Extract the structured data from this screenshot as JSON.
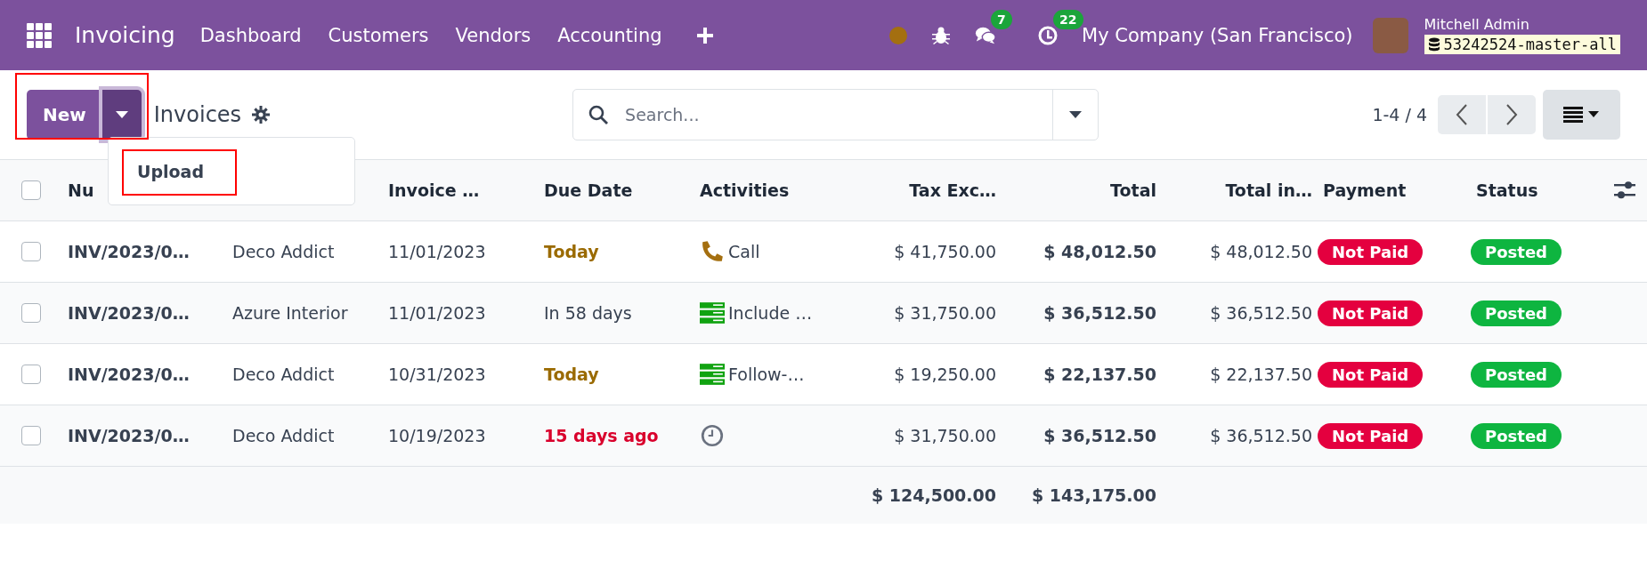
{
  "navbar": {
    "app_name": "Invoicing",
    "menu": [
      "Dashboard",
      "Customers",
      "Vendors",
      "Accounting"
    ],
    "chat_badge": "7",
    "activity_badge": "22",
    "company": "My Company (San Francisco)",
    "user": "Mitchell Admin",
    "database": "53242524-master-all"
  },
  "control_panel": {
    "new_button": "New",
    "highlighted": true,
    "title": "Invoices",
    "search": {
      "placeholder": "Search..."
    },
    "pager": "1-4 / 4"
  },
  "new_menu": {
    "items": [
      {
        "label": "Upload",
        "highlighted": true
      }
    ]
  },
  "table": {
    "all_selected": false,
    "columns": [
      "Nu",
      "Invoice …",
      "Due Date",
      "Activities",
      "Tax Exc…",
      "Total",
      "Total in…",
      "Payment",
      "Status"
    ],
    "rows": [
      {
        "selected": false,
        "number": "INV/2023/0…",
        "customer": "Deco Addict",
        "invoice_date": "11/01/2023",
        "due": {
          "text": "Today",
          "kind": "today"
        },
        "activity": {
          "kind": "phone",
          "text": "Call"
        },
        "tax_excluded": "$ 41,750.00",
        "total": "$ 48,012.50",
        "total_signed": "$ 48,012.50",
        "payment": {
          "text": "Not Paid",
          "kind": "danger"
        },
        "status": {
          "text": "Posted",
          "kind": "success"
        }
      },
      {
        "selected": false,
        "number": "INV/2023/0…",
        "customer": "Azure Interior",
        "invoice_date": "11/01/2023",
        "due": {
          "text": "In 58 days",
          "kind": "future"
        },
        "activity": {
          "kind": "todo",
          "text": "Include …"
        },
        "tax_excluded": "$ 31,750.00",
        "total": "$ 36,512.50",
        "total_signed": "$ 36,512.50",
        "payment": {
          "text": "Not Paid",
          "kind": "danger"
        },
        "status": {
          "text": "Posted",
          "kind": "success"
        }
      },
      {
        "selected": false,
        "number": "INV/2023/0…",
        "customer": "Deco Addict",
        "invoice_date": "10/31/2023",
        "due": {
          "text": "Today",
          "kind": "today"
        },
        "activity": {
          "kind": "todo",
          "text": "Follow-…"
        },
        "tax_excluded": "$ 19,250.00",
        "total": "$ 22,137.50",
        "total_signed": "$ 22,137.50",
        "payment": {
          "text": "Not Paid",
          "kind": "danger"
        },
        "status": {
          "text": "Posted",
          "kind": "success"
        }
      },
      {
        "selected": false,
        "number": "INV/2023/0…",
        "customer": "Deco Addict",
        "invoice_date": "10/19/2023",
        "due": {
          "text": "15 days ago",
          "kind": "overdue"
        },
        "activity": {
          "kind": "clock"
        },
        "tax_excluded": "$ 31,750.00",
        "total": "$ 36,512.50",
        "total_signed": "$ 36,512.50",
        "payment": {
          "text": "Not Paid",
          "kind": "danger"
        },
        "status": {
          "text": "Posted",
          "kind": "success"
        }
      }
    ],
    "totals": {
      "tax_excluded": "$ 124,500.00",
      "total": "$ 143,175.00"
    }
  }
}
